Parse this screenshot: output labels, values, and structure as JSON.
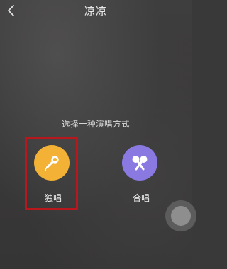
{
  "header": {
    "title": "凉凉",
    "back_icon": "chevron-left-icon"
  },
  "prompt": "选择一种演唱方式",
  "options": [
    {
      "label": "独唱",
      "icon": "microphone-icon",
      "color": "#f3b136",
      "selected": true
    },
    {
      "label": "合唱",
      "icon": "two-microphones-icon",
      "color": "#8b79e2",
      "selected": false
    }
  ],
  "highlight_color": "#b8171d",
  "floating_button_icon": "assistive-touch-icon"
}
